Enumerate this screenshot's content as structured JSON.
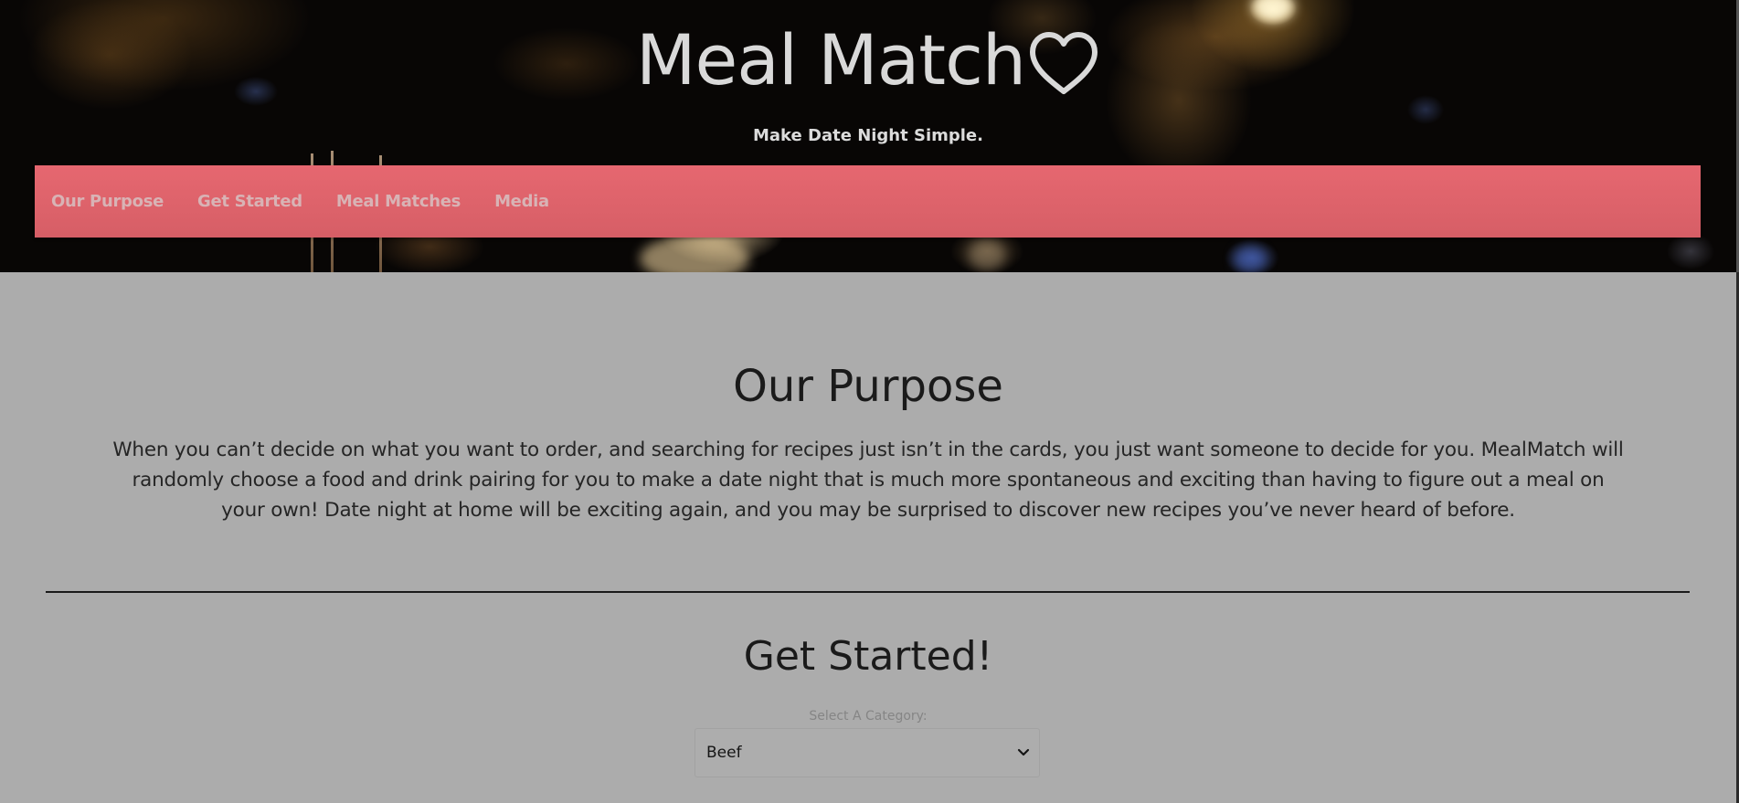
{
  "header": {
    "title": "Meal Match",
    "title_icon": "heart-outline-icon",
    "tagline": "Make Date Night Simple."
  },
  "nav": {
    "items": [
      {
        "label": "Our Purpose"
      },
      {
        "label": "Get Started"
      },
      {
        "label": "Meal Matches"
      },
      {
        "label": "Media"
      }
    ]
  },
  "purpose": {
    "heading": "Our Purpose",
    "body": "When you can’t decide on what you want to order, and searching for recipes just isn’t in the cards, you just want someone to decide for you. MealMatch will randomly choose a food and drink pairing for you to make a date night that is much more spontaneous and exciting than having to figure out a meal on your own! Date night at home will be exciting again, and you may be surprised to discover new recipes you’ve never heard of before."
  },
  "get_started": {
    "heading": "Get Started!",
    "select_label": "Select A Category:",
    "selected_category": "Beef"
  },
  "colors": {
    "nav_background": "#e0646c",
    "nav_text": "#d8b3b5",
    "content_background": "#acacac",
    "title_text": "#d9d9d9"
  }
}
